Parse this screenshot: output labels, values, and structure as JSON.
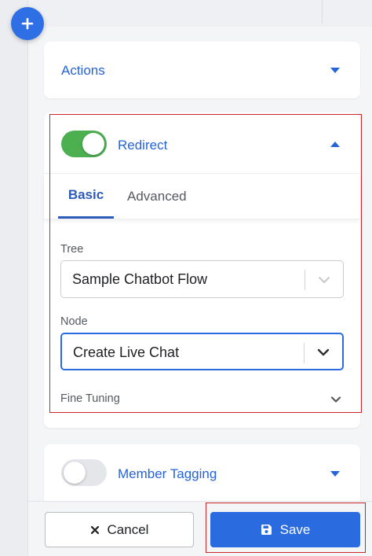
{
  "actions": {
    "title": "Actions"
  },
  "redirect": {
    "title": "Redirect",
    "enabled": true,
    "tabs": [
      {
        "label": "Basic",
        "active": true
      },
      {
        "label": "Advanced",
        "active": false
      }
    ],
    "tree": {
      "label": "Tree",
      "value": "Sample Chatbot Flow"
    },
    "node": {
      "label": "Node",
      "value": "Create Live Chat"
    },
    "fine_tuning": {
      "label": "Fine Tuning"
    }
  },
  "member_tagging": {
    "title": "Member Tagging",
    "enabled": false
  },
  "footer": {
    "cancel_label": "Cancel",
    "save_label": "Save"
  },
  "colors": {
    "accent": "#2a6be0",
    "toggle_on": "#4caf50",
    "highlight": "#c9262c"
  },
  "icons": {
    "fab": "plus-icon",
    "cancel": "close-icon",
    "save": "floppy-disk-icon"
  }
}
